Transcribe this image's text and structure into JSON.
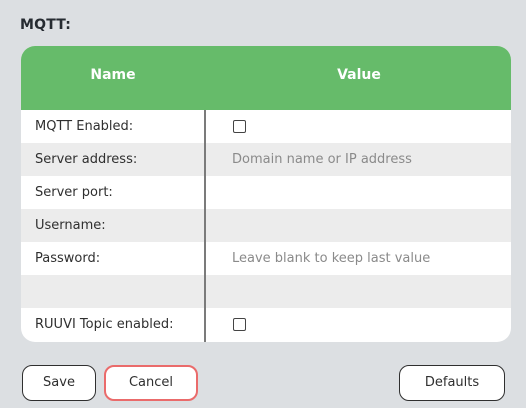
{
  "section": {
    "title": "MQTT:"
  },
  "table": {
    "headers": {
      "name": "Name",
      "value": "Value"
    },
    "rows": [
      {
        "label": "MQTT Enabled:",
        "type": "checkbox",
        "checked": false
      },
      {
        "label": "Server address:",
        "type": "text",
        "placeholder": "Domain name or IP address"
      },
      {
        "label": "Server port:",
        "type": "text",
        "placeholder": ""
      },
      {
        "label": "Username:",
        "type": "text",
        "placeholder": ""
      },
      {
        "label": "Password:",
        "type": "password",
        "placeholder": "Leave blank to keep last value"
      },
      {
        "label": "",
        "type": "empty"
      },
      {
        "label": "RUUVI Topic enabled:",
        "type": "checkbox",
        "checked": false
      }
    ]
  },
  "buttons": {
    "save": "Save",
    "cancel": "Cancel",
    "defaults": "Defaults"
  },
  "colors": {
    "header_bg": "#66bb6a",
    "page_bg": "#dcdfe2",
    "row_shade": "#ececec",
    "cancel_border": "#ea6b6b"
  }
}
